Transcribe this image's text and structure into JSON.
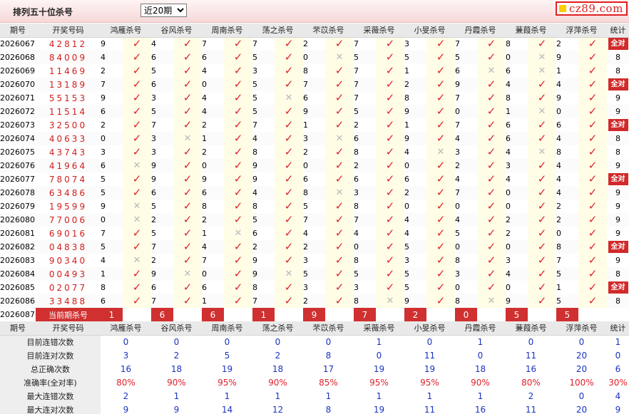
{
  "header": {
    "title": "排列五十位杀号",
    "period_select": "近20期",
    "logo_text": "cz89.com"
  },
  "colors": {
    "check": "#e0202a",
    "cross": "#b8b8b8",
    "badge": "#d22a2a",
    "stat_blue": "#1a33c0",
    "stat_red": "#e0202a"
  },
  "columns": {
    "period": "期号",
    "draw": "开奖号码",
    "experts": [
      "鸿雁杀号",
      "谷风杀号",
      "周南杀号",
      "荡之杀号",
      "芣苡杀号",
      "采薇杀号",
      "小旻杀号",
      "丹霞杀号",
      "蒹葭杀号",
      "浮萍杀号"
    ],
    "stat": "统计"
  },
  "icons": {
    "hit": "check-icon",
    "miss": "cross-icon"
  },
  "rows": [
    {
      "period": "2026067",
      "draw": "42812",
      "nums": [
        "9",
        "4",
        "7",
        "7",
        "2",
        "7",
        "3",
        "7",
        "8",
        "2"
      ],
      "hits": [
        1,
        1,
        1,
        1,
        1,
        1,
        1,
        1,
        1,
        1
      ],
      "stat": "全对",
      "all": true
    },
    {
      "period": "2026068",
      "draw": "84009",
      "nums": [
        "4",
        "6",
        "6",
        "5",
        "0",
        "5",
        "5",
        "5",
        "0",
        "9"
      ],
      "hits": [
        1,
        1,
        1,
        1,
        0,
        1,
        1,
        1,
        0,
        1
      ],
      "stat": "8",
      "all": false
    },
    {
      "period": "2026069",
      "draw": "11469",
      "nums": [
        "2",
        "5",
        "4",
        "3",
        "8",
        "7",
        "1",
        "6",
        "6",
        "1"
      ],
      "hits": [
        1,
        1,
        1,
        1,
        1,
        1,
        1,
        0,
        0,
        1
      ],
      "stat": "8",
      "all": false
    },
    {
      "period": "2026070",
      "draw": "13189",
      "nums": [
        "7",
        "6",
        "0",
        "5",
        "7",
        "7",
        "2",
        "9",
        "4",
        "4"
      ],
      "hits": [
        1,
        1,
        1,
        1,
        1,
        1,
        1,
        1,
        1,
        1
      ],
      "stat": "全对",
      "all": true
    },
    {
      "period": "2026071",
      "draw": "55153",
      "nums": [
        "9",
        "3",
        "4",
        "5",
        "6",
        "7",
        "8",
        "7",
        "8",
        "9"
      ],
      "hits": [
        1,
        1,
        1,
        0,
        1,
        1,
        1,
        1,
        1,
        1
      ],
      "stat": "9",
      "all": false
    },
    {
      "period": "2026072",
      "draw": "11514",
      "nums": [
        "6",
        "5",
        "4",
        "5",
        "9",
        "5",
        "9",
        "0",
        "1",
        "0"
      ],
      "hits": [
        1,
        1,
        1,
        1,
        1,
        1,
        1,
        1,
        0,
        1
      ],
      "stat": "9",
      "all": false
    },
    {
      "period": "2026073",
      "draw": "32500",
      "nums": [
        "2",
        "7",
        "2",
        "7",
        "1",
        "2",
        "1",
        "7",
        "6",
        "6"
      ],
      "hits": [
        1,
        1,
        1,
        1,
        1,
        1,
        1,
        1,
        1,
        1
      ],
      "stat": "全对",
      "all": true
    },
    {
      "period": "2026074",
      "draw": "40633",
      "nums": [
        "0",
        "3",
        "1",
        "4",
        "3",
        "6",
        "9",
        "4",
        "6",
        "4"
      ],
      "hits": [
        1,
        0,
        1,
        1,
        0,
        1,
        1,
        1,
        1,
        1
      ],
      "stat": "8",
      "all": false
    },
    {
      "period": "2026075",
      "draw": "43743",
      "nums": [
        "3",
        "3",
        "2",
        "8",
        "2",
        "8",
        "4",
        "3",
        "4",
        "8"
      ],
      "hits": [
        1,
        1,
        1,
        1,
        1,
        1,
        0,
        1,
        0,
        1
      ],
      "stat": "8",
      "all": false
    },
    {
      "period": "2026076",
      "draw": "41964",
      "nums": [
        "6",
        "9",
        "0",
        "9",
        "0",
        "2",
        "0",
        "2",
        "3",
        "4"
      ],
      "hits": [
        0,
        1,
        1,
        1,
        1,
        1,
        1,
        1,
        1,
        1
      ],
      "stat": "9",
      "all": false
    },
    {
      "period": "2026077",
      "draw": "78074",
      "nums": [
        "5",
        "9",
        "9",
        "9",
        "6",
        "6",
        "6",
        "4",
        "4",
        "4"
      ],
      "hits": [
        1,
        1,
        1,
        1,
        1,
        1,
        1,
        1,
        1,
        1
      ],
      "stat": "全对",
      "all": true
    },
    {
      "period": "2026078",
      "draw": "63486",
      "nums": [
        "5",
        "6",
        "6",
        "4",
        "8",
        "3",
        "2",
        "7",
        "0",
        "4"
      ],
      "hits": [
        1,
        1,
        1,
        1,
        0,
        1,
        1,
        1,
        1,
        1
      ],
      "stat": "9",
      "all": false
    },
    {
      "period": "2026079",
      "draw": "19599",
      "nums": [
        "9",
        "5",
        "8",
        "8",
        "5",
        "8",
        "0",
        "0",
        "0",
        "2"
      ],
      "hits": [
        0,
        1,
        1,
        1,
        1,
        1,
        1,
        1,
        1,
        1
      ],
      "stat": "9",
      "all": false
    },
    {
      "period": "2026080",
      "draw": "77006",
      "nums": [
        "0",
        "2",
        "2",
        "5",
        "7",
        "7",
        "4",
        "4",
        "2",
        "2"
      ],
      "hits": [
        0,
        1,
        1,
        1,
        1,
        1,
        1,
        1,
        1,
        1
      ],
      "stat": "9",
      "all": false
    },
    {
      "period": "2026081",
      "draw": "69016",
      "nums": [
        "7",
        "5",
        "1",
        "6",
        "4",
        "4",
        "4",
        "5",
        "2",
        "0"
      ],
      "hits": [
        1,
        1,
        0,
        1,
        1,
        1,
        1,
        1,
        1,
        1
      ],
      "stat": "9",
      "all": false
    },
    {
      "period": "2026082",
      "draw": "04838",
      "nums": [
        "5",
        "7",
        "4",
        "2",
        "2",
        "0",
        "5",
        "0",
        "0",
        "8"
      ],
      "hits": [
        1,
        1,
        1,
        1,
        1,
        1,
        1,
        1,
        1,
        1
      ],
      "stat": "全对",
      "all": true
    },
    {
      "period": "2026083",
      "draw": "90340",
      "nums": [
        "4",
        "2",
        "7",
        "9",
        "3",
        "8",
        "3",
        "8",
        "3",
        "7"
      ],
      "hits": [
        0,
        1,
        1,
        1,
        1,
        1,
        1,
        1,
        1,
        1
      ],
      "stat": "9",
      "all": false
    },
    {
      "period": "2026084",
      "draw": "00493",
      "nums": [
        "1",
        "9",
        "0",
        "9",
        "5",
        "5",
        "5",
        "3",
        "4",
        "5"
      ],
      "hits": [
        1,
        0,
        1,
        0,
        1,
        1,
        1,
        1,
        1,
        1
      ],
      "stat": "8",
      "all": false
    },
    {
      "period": "2026085",
      "draw": "02077",
      "nums": [
        "8",
        "6",
        "6",
        "8",
        "3",
        "3",
        "5",
        "0",
        "0",
        "1"
      ],
      "hits": [
        1,
        1,
        1,
        1,
        1,
        1,
        1,
        1,
        1,
        1
      ],
      "stat": "全对",
      "all": true
    },
    {
      "period": "2026086",
      "draw": "33488",
      "nums": [
        "6",
        "7",
        "1",
        "7",
        "2",
        "8",
        "9",
        "8",
        "9",
        "5"
      ],
      "hits": [
        1,
        1,
        1,
        1,
        1,
        0,
        1,
        0,
        1,
        1
      ],
      "stat": "8",
      "all": false
    }
  ],
  "current": {
    "period": "2026087",
    "label": "当前期杀号",
    "nums": [
      "1",
      "6",
      "6",
      "1",
      "9",
      "7",
      "2",
      "0",
      "5",
      "5"
    ]
  },
  "stats": [
    {
      "label": "目前连错次数",
      "values": [
        "0",
        "0",
        "0",
        "0",
        "0",
        "1",
        "0",
        "1",
        "0",
        "0",
        "1"
      ],
      "pct": false
    },
    {
      "label": "目前连对次数",
      "values": [
        "3",
        "2",
        "5",
        "2",
        "8",
        "0",
        "11",
        "0",
        "11",
        "20",
        "0"
      ],
      "pct": false
    },
    {
      "label": "总正确次数",
      "values": [
        "16",
        "18",
        "19",
        "18",
        "17",
        "19",
        "19",
        "18",
        "16",
        "20",
        "6"
      ],
      "pct": false
    },
    {
      "label": "准确率(全对率)",
      "values": [
        "80%",
        "90%",
        "95%",
        "90%",
        "85%",
        "95%",
        "95%",
        "90%",
        "80%",
        "100%",
        "30%"
      ],
      "pct": true
    },
    {
      "label": "最大连错次数",
      "values": [
        "2",
        "1",
        "1",
        "1",
        "1",
        "1",
        "1",
        "1",
        "2",
        "0",
        "4"
      ],
      "pct": false
    },
    {
      "label": "最大连对次数",
      "values": [
        "9",
        "9",
        "14",
        "12",
        "8",
        "19",
        "11",
        "16",
        "11",
        "20",
        "9"
      ],
      "pct": false
    }
  ]
}
